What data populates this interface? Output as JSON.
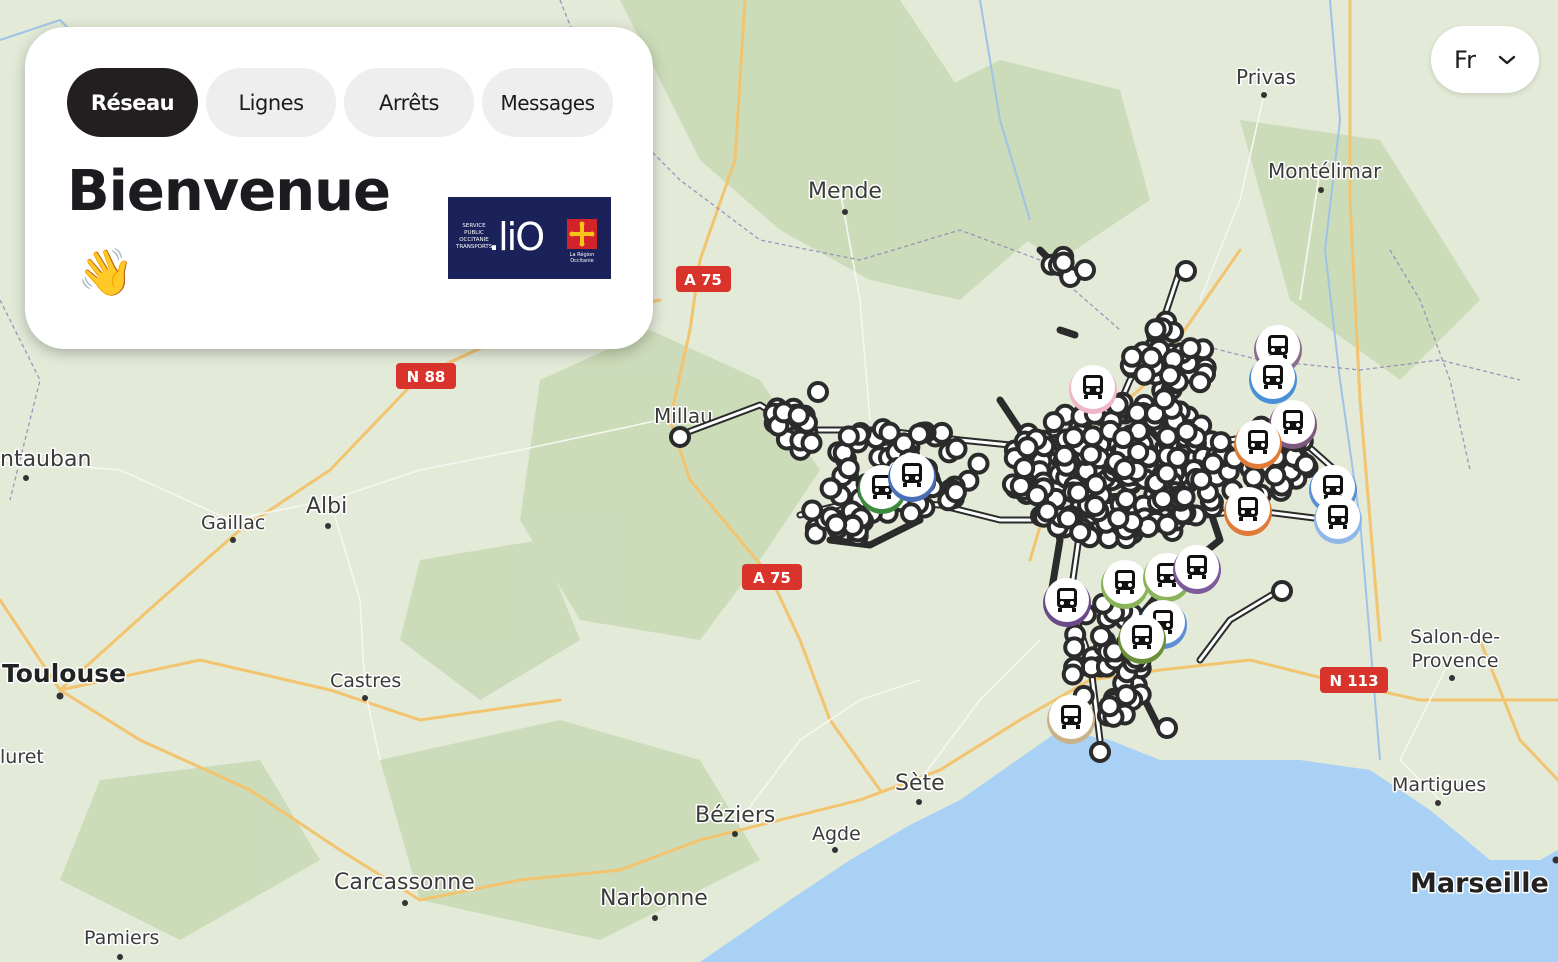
{
  "tabs": [
    {
      "label": "Réseau",
      "active": true
    },
    {
      "label": "Lignes",
      "active": false
    },
    {
      "label": "Arrêts",
      "active": false
    },
    {
      "label": "Messages",
      "active": false
    }
  ],
  "welcome": {
    "title": "Bienvenue",
    "emoji": "👋"
  },
  "logo": {
    "brand": ".liO",
    "small_text": "SERVICE PUBLIC OCCITANIE TRANSPORTS",
    "region_text": "La Région Occitanie"
  },
  "language": {
    "value": "Fr",
    "icon": "chevron-down-icon"
  },
  "map": {
    "cities": [
      "Privas",
      "Montélimar",
      "Mende",
      "Millau",
      "ntauban",
      "Albi",
      "Gaillac",
      "Toulouse",
      "Castres",
      "luret",
      "Sète",
      "Béziers",
      "Agde",
      "Carcassonne",
      "Narbonne",
      "Pamiers",
      "Salon-de-Provence",
      "Martigues",
      "Marseille"
    ],
    "roads": [
      "A 75",
      "N 88",
      "A 75",
      "N 113"
    ],
    "colors": {
      "land": "#e3ead8",
      "forest": "#c8d9b4",
      "sea": "#a9d1f5",
      "route": "#ffffff",
      "stop_border": "#2b2b2b",
      "road_badge": "#d9342b",
      "city_road": "#f2c46f"
    }
  }
}
